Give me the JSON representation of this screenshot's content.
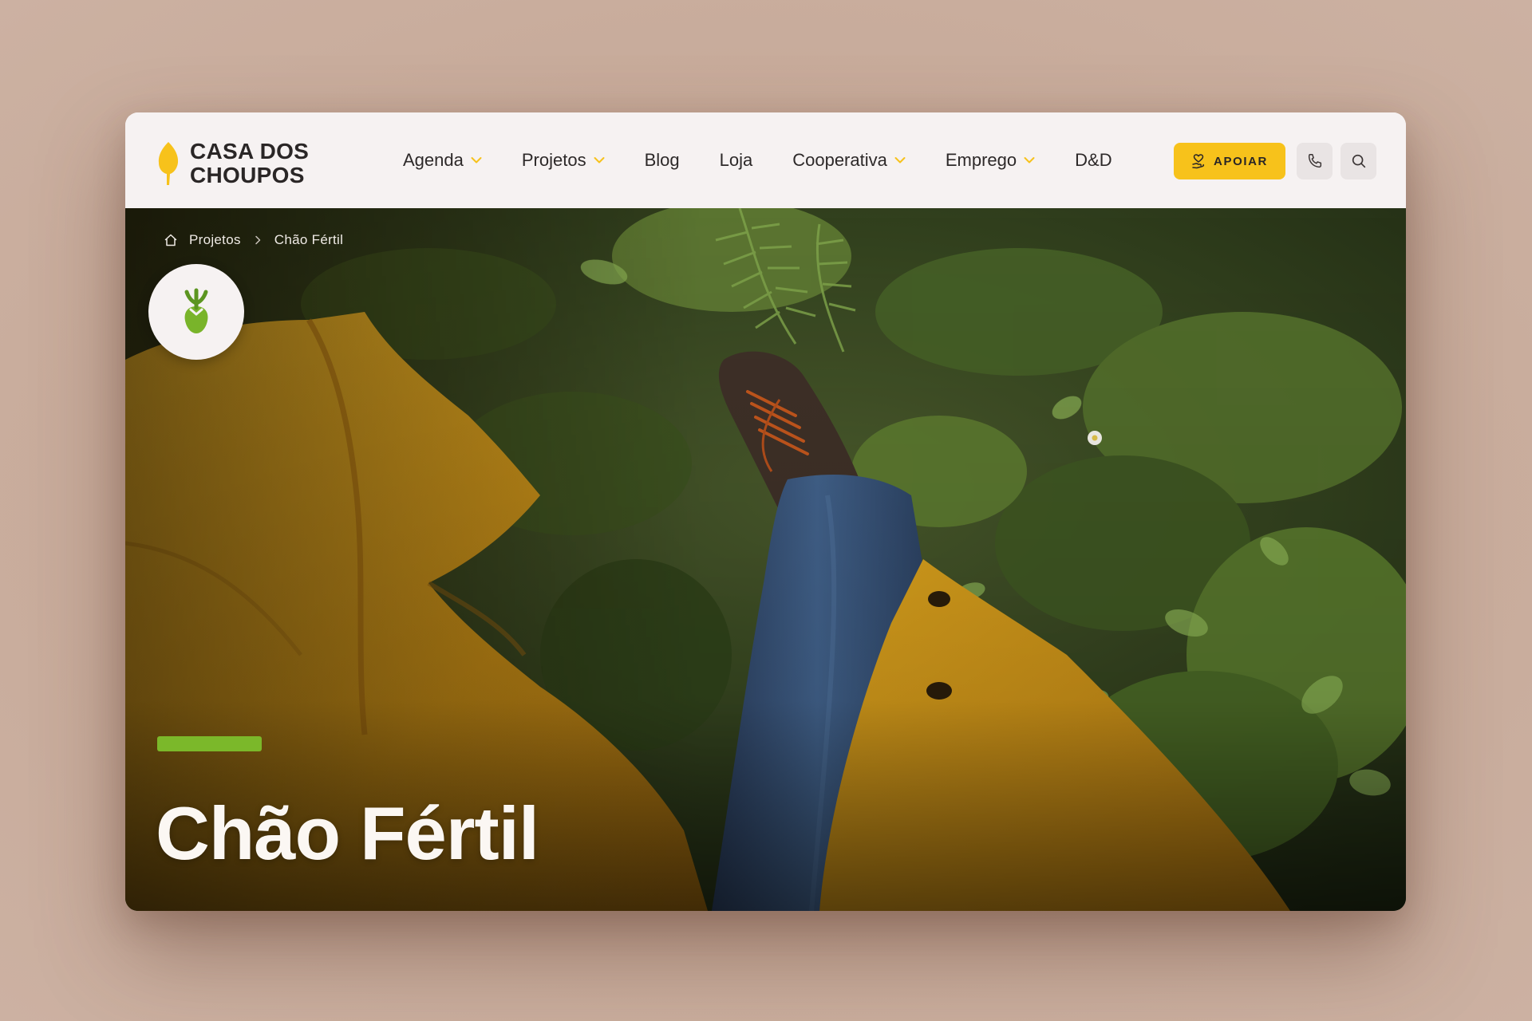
{
  "brand": {
    "line1": "CASA DOS",
    "line2": "CHOUPOS",
    "logo_icon": "poplar-leaf-icon",
    "accent": "#f7c21b"
  },
  "nav": {
    "items": [
      {
        "label": "Agenda",
        "dropdown": true
      },
      {
        "label": "Projetos",
        "dropdown": true
      },
      {
        "label": "Blog",
        "dropdown": false
      },
      {
        "label": "Loja",
        "dropdown": false
      },
      {
        "label": "Cooperativa",
        "dropdown": true
      },
      {
        "label": "Emprego",
        "dropdown": true
      },
      {
        "label": "D&D",
        "dropdown": false
      }
    ]
  },
  "actions": {
    "support_label": "APOIAR",
    "support_icon": "heart-hand-icon",
    "phone_icon": "phone-icon",
    "search_icon": "search-icon"
  },
  "breadcrumb": {
    "home_icon": "home-icon",
    "items": [
      "Projetos",
      "Chão Fértil"
    ]
  },
  "hero": {
    "badge_icon": "sprout-icon",
    "title": "Chão Fértil",
    "accent_color": "#7bb82a"
  }
}
